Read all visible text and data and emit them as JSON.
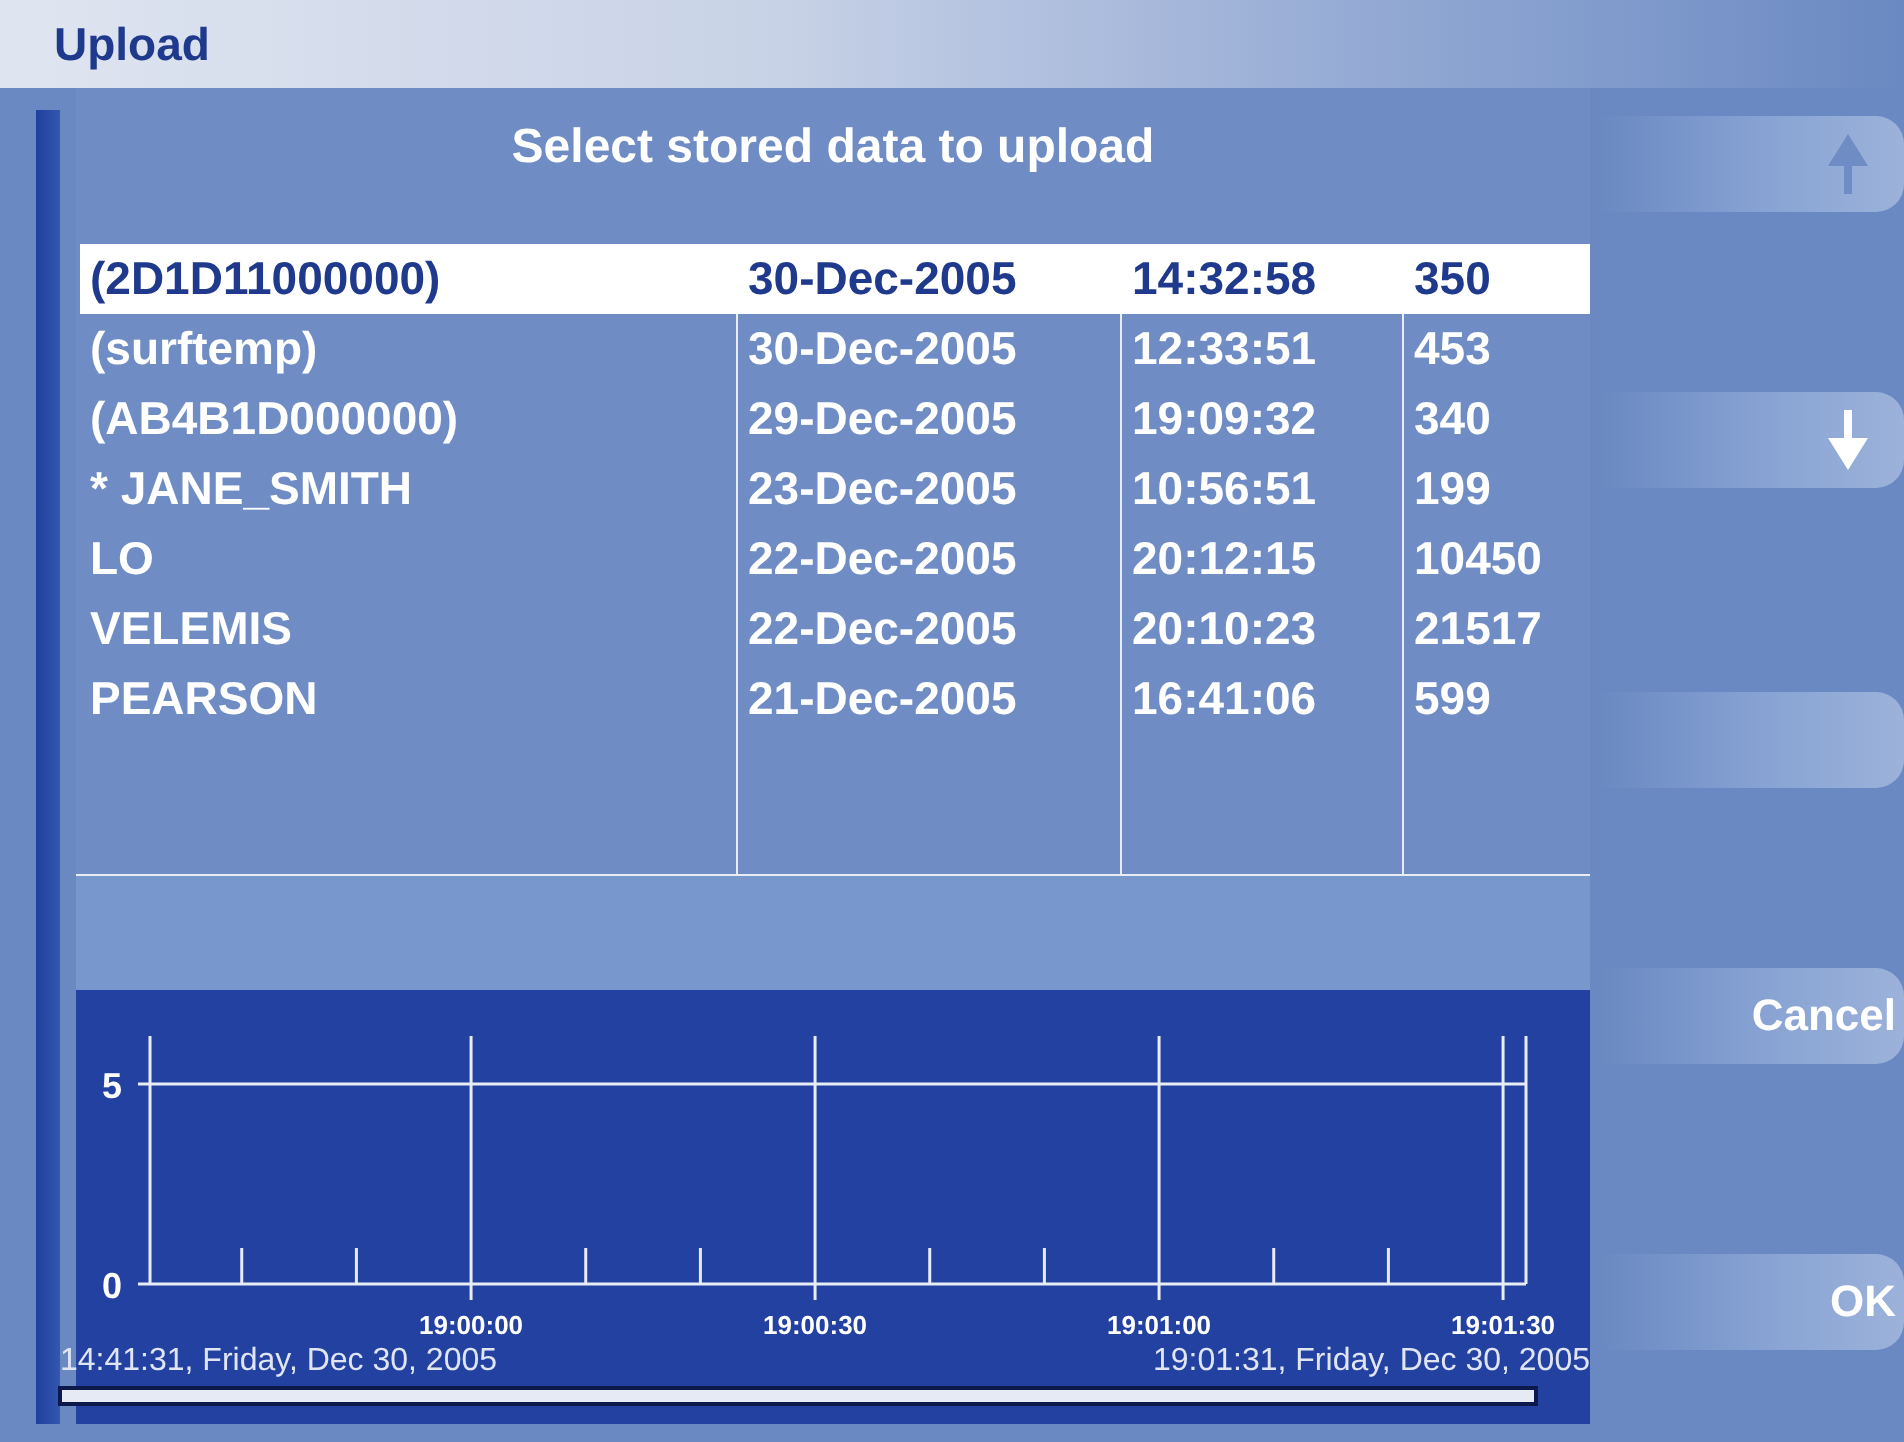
{
  "window": {
    "title": "Upload"
  },
  "heading": "Select stored data to upload",
  "table": {
    "rows": [
      {
        "name": "(2D1D11000000)",
        "date": "30-Dec-2005",
        "time": "14:32:58",
        "size": "350",
        "selected": true
      },
      {
        "name": "(surftemp)",
        "date": "30-Dec-2005",
        "time": "12:33:51",
        "size": "453",
        "selected": false
      },
      {
        "name": "(AB4B1D000000)",
        "date": "29-Dec-2005",
        "time": "19:09:32",
        "size": "340",
        "selected": false
      },
      {
        "name": "* JANE_SMITH",
        "date": "23-Dec-2005",
        "time": "10:56:51",
        "size": "199",
        "selected": false
      },
      {
        "name": "LO",
        "date": "22-Dec-2005",
        "time": "20:12:15",
        "size": "10450",
        "selected": false
      },
      {
        "name": "VELEMIS",
        "date": "22-Dec-2005",
        "time": "20:10:23",
        "size": "21517",
        "selected": false
      },
      {
        "name": "PEARSON",
        "date": "21-Dec-2005",
        "time": "16:41:06",
        "size": "599",
        "selected": false
      }
    ]
  },
  "chart": {
    "chart_data": {
      "type": "line",
      "grid": true,
      "ylim": [
        0,
        6.2
      ],
      "yticks": [
        0,
        5
      ],
      "categories": [
        null,
        null,
        "19:00:00",
        null,
        null,
        "19:00:30",
        null,
        null,
        "19:01:00",
        null,
        null,
        "19:01:30"
      ]
    },
    "start_label": "14:41:31, Friday, Dec 30, 2005",
    "end_label": "19:01:31, Friday, Dec 30, 2005"
  },
  "buttons": [
    {
      "kind": "arrow-up",
      "disabled": true
    },
    {
      "kind": "arrow-down",
      "disabled": false
    },
    {
      "kind": "blank"
    },
    {
      "kind": "text",
      "label": "Cancel"
    },
    {
      "kind": "text",
      "label": "OK"
    }
  ]
}
